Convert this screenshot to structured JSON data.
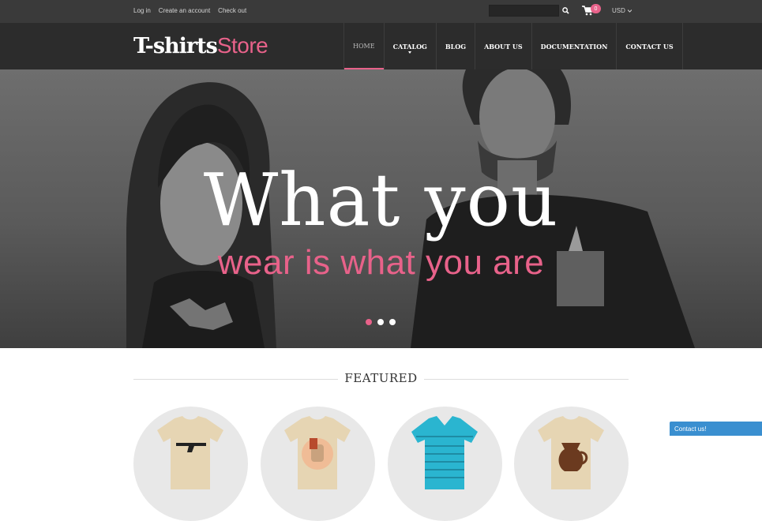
{
  "topbar": {
    "links": [
      "Log in",
      "Create an account",
      "Check out"
    ],
    "search_placeholder": "",
    "cart_count": "0",
    "currency": "USD"
  },
  "header": {
    "logo_bold": "T-shirts",
    "logo_light": "Store",
    "nav": [
      {
        "label": "HOME",
        "active": true
      },
      {
        "label": "CATALOG",
        "dropdown": true
      },
      {
        "label": "BLOG"
      },
      {
        "label": "ABOUT US"
      },
      {
        "label": "DOCUMENTATION"
      },
      {
        "label": "CONTACT US"
      }
    ]
  },
  "hero": {
    "title": "What you",
    "subtitle": "wear is what you are",
    "slides": 3,
    "active_slide": 1
  },
  "featured": {
    "title": "FEATURED",
    "products": [
      {
        "icon": "rifle-tshirt-icon"
      },
      {
        "icon": "fist-tshirt-icon"
      },
      {
        "icon": "striped-polo-icon"
      },
      {
        "icon": "coffee-pot-tshirt-icon"
      }
    ]
  },
  "contact_tab": "Contact us!",
  "colors": {
    "accent": "#e8628a",
    "topbar": "#3a3a3a",
    "header": "#2c2c2c",
    "contact": "#3a8fd0"
  }
}
